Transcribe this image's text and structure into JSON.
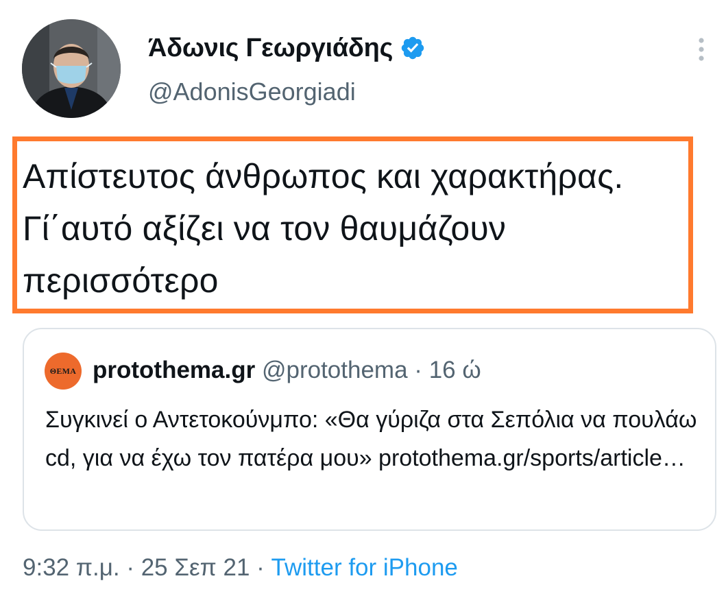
{
  "user": {
    "display_name": "Άδωνις Γεωργιάδης",
    "handle": "@AdonisGeorgiadi",
    "verified_icon": "verified-badge-icon"
  },
  "tweet": {
    "text": "Απίστευτος άνθρωπος και χαρακτήρας. Γί΄αυτό αξίζει να τον θαυμάζουν περισσότερο",
    "highlight_color": "#ff7a2e"
  },
  "quoted_tweet": {
    "logo_text": "ΘΕΜΑ",
    "name": "protothema.gr",
    "handle": "@protothema",
    "separator": "·",
    "age": "16 ώ",
    "text": "Συγκινεί ο Αντετοκούνμπο: «Θα γύριζα στα Σεπόλια να πουλάω cd, για να έχω τον πατέρα μου» protothema.gr/sports/article…"
  },
  "meta": {
    "time": "9:32 π.μ.",
    "separator1": " · ",
    "date": "25 Σεπ 21",
    "separator2": " · ",
    "source": "Twitter for iPhone"
  },
  "colors": {
    "text": "#0f1419",
    "secondary": "#536471",
    "link": "#1d9bf0",
    "verified": "#1d9bf0",
    "border": "#dde3e8"
  }
}
